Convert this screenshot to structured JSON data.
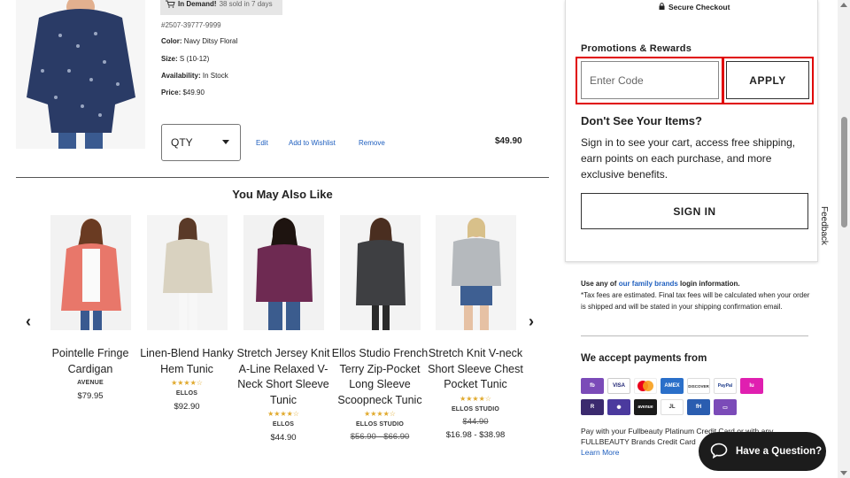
{
  "cart_item": {
    "demand_bold": "In Demand!",
    "demand_text": "38 sold in 7 days",
    "sku": "#2507-39777-9999",
    "color_label": "Color:",
    "color_value": "Navy Ditsy Floral",
    "size_label": "Size:",
    "size_value": "S (10-12)",
    "availability_label": "Availability:",
    "availability_value": "In Stock",
    "price_label": "Price:",
    "price_value": "$49.90",
    "qty_label": "QTY",
    "edit": "Edit",
    "wishlist": "Add to Wishlist",
    "remove": "Remove",
    "line_total": "$49.90"
  },
  "recommendations": {
    "heading": "You May Also Like",
    "prev_arrow": "‹",
    "next_arrow": "›",
    "items": [
      {
        "name": "Pointelle Fringe Cardigan",
        "brand": "AVENUE",
        "price": "$79.95",
        "stars": "",
        "strike": ""
      },
      {
        "name": "Linen-Blend Hanky Hem Tunic",
        "brand": "ELLOS",
        "price": "$92.90",
        "stars": "★★★★☆",
        "strike": ""
      },
      {
        "name": "Stretch Jersey Knit A-Line Relaxed V-Neck Short Sleeve Tunic",
        "brand": "ELLOS",
        "price": "$44.90",
        "stars": "★★★★☆",
        "strike": ""
      },
      {
        "name": "Ellos Studio French Terry Zip-Pocket Long Sleeve Scoopneck Tunic",
        "brand": "ELLOS STUDIO",
        "price": "",
        "stars": "★★★★☆",
        "strike": "$56.90 - $66.90"
      },
      {
        "name": "Stretch Knit V-neck Short Sleeve Chest Pocket Tunic",
        "brand": "ELLOS STUDIO",
        "price": "$16.98 - $38.98",
        "stars": "★★★★☆",
        "strike": "$44.90"
      }
    ]
  },
  "summary": {
    "secure_checkout": "Secure Checkout",
    "promo_heading": "Promotions & Rewards",
    "code_placeholder": "Enter Code",
    "apply": "APPLY",
    "dont_see_heading": "Don't See Your Items?",
    "dont_see_text": "Sign in to see your cart, access free shipping, earn points on each purchase, and more exclusive benefits.",
    "sign_in": "SIGN IN",
    "feedback": "Feedback",
    "family_prefix": "Use any of ",
    "family_link": "our family brands",
    "family_suffix": " login information.",
    "tax_note": "*Tax fees are estimated. Final tax fees will be calculated when your order is shipped and will be stated in your shipping confirmation email.",
    "accept_heading": "We accept payments from",
    "payments_row1": [
      {
        "label": "fb",
        "color": "#7b4bb8"
      },
      {
        "label": "VISA",
        "color": "#ffffff"
      },
      {
        "label": "",
        "color": "#ffffff"
      },
      {
        "label": "AMEX",
        "color": "#2a6fc9"
      },
      {
        "label": "DISCOVER",
        "color": "#ffffff"
      },
      {
        "label": "PayPal",
        "color": "#ffffff"
      },
      {
        "label": "lu",
        "color": "#e01fb0"
      }
    ],
    "payments_row2": [
      {
        "label": "R",
        "color": "#3b2a6e"
      },
      {
        "label": "✺",
        "color": "#4b3a9e"
      },
      {
        "label": "avenue",
        "color": "#1b1b1b"
      },
      {
        "label": "JL",
        "color": "#ffffff"
      },
      {
        "label": "fH",
        "color": "#2a5db0"
      },
      {
        "label": "▭",
        "color": "#7b4bb8"
      }
    ],
    "pay_note": "Pay with your Fullbeauty Platinum Credit Card or with any FULLBEAUTY Brands Credit Card",
    "learn_more": "Learn More",
    "question": "Have a Question?"
  }
}
